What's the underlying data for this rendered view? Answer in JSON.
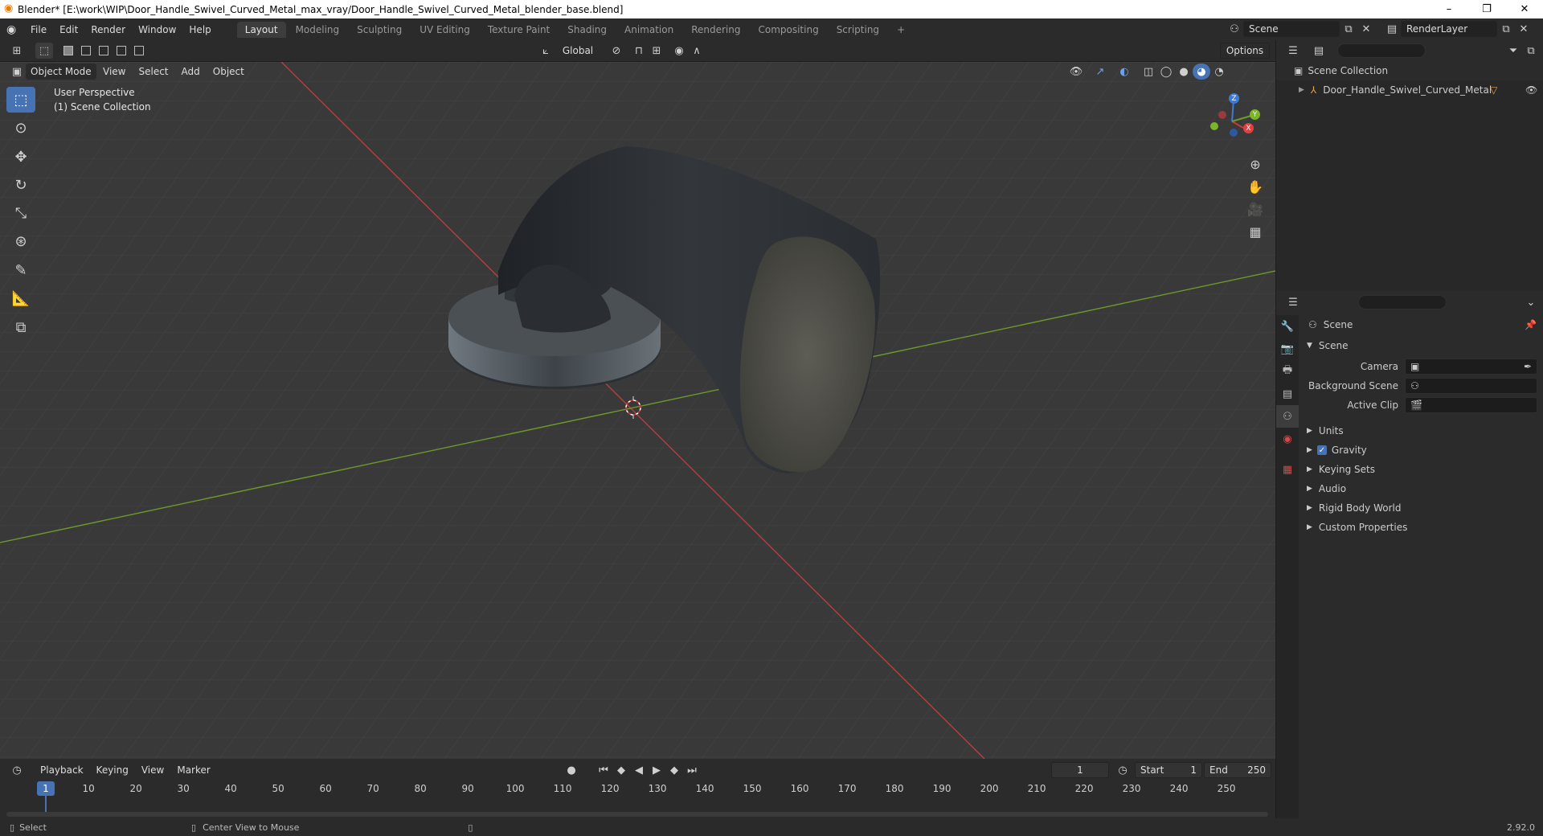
{
  "window": {
    "title": "Blender* [E:\\work\\WIP\\Door_Handle_Swivel_Curved_Metal_max_vray/Door_Handle_Swivel_Curved_Metal_blender_base.blend]",
    "minimize": "–",
    "maximize": "❐",
    "close": "✕"
  },
  "menu": [
    "File",
    "Edit",
    "Render",
    "Window",
    "Help"
  ],
  "workspaces": [
    "Layout",
    "Modeling",
    "Sculpting",
    "UV Editing",
    "Texture Paint",
    "Shading",
    "Animation",
    "Rendering",
    "Compositing",
    "Scripting"
  ],
  "workspace_add": "+",
  "scene_selector": "Scene",
  "renderlayer_selector": "RenderLayer",
  "viewport_header": {
    "mode": "Object Mode",
    "menus": [
      "View",
      "Select",
      "Add",
      "Object"
    ],
    "transform_orientation": "Global",
    "options": "Options"
  },
  "viewport_overlay": {
    "perspective": "User Perspective",
    "collection": "(1) Scene Collection"
  },
  "gizmo": {
    "x": "X",
    "y": "Y",
    "z": "Z"
  },
  "outliner": {
    "root": "Scene Collection",
    "items": [
      {
        "name": "Door_Handle_Swivel_Curved_Metal"
      }
    ]
  },
  "properties": {
    "header": "Scene",
    "panel_title": "Scene",
    "fields": [
      {
        "label": "Camera",
        "value": ""
      },
      {
        "label": "Background Scene",
        "value": ""
      },
      {
        "label": "Active Clip",
        "value": ""
      }
    ],
    "collapsed": [
      "Units",
      "Gravity",
      "Keying Sets",
      "Audio",
      "Rigid Body World",
      "Custom Properties"
    ]
  },
  "timeline": {
    "menus": [
      "Playback",
      "Keying",
      "View",
      "Marker"
    ],
    "current_frame": "1",
    "start_label": "Start",
    "start": "1",
    "end_label": "End",
    "end": "250",
    "ticks": [
      "1",
      "10",
      "20",
      "30",
      "40",
      "50",
      "60",
      "70",
      "80",
      "90",
      "100",
      "110",
      "120",
      "130",
      "140",
      "150",
      "160",
      "170",
      "180",
      "190",
      "200",
      "210",
      "220",
      "230",
      "240",
      "250"
    ]
  },
  "status": {
    "left": "Select",
    "middle": "Center View to Mouse",
    "version": "2.92.0"
  },
  "colors": {
    "accent": "#4772b3",
    "x_axis": "#c73a3a",
    "y_axis": "#6d9a2a",
    "z_axis": "#3b7bd8"
  }
}
